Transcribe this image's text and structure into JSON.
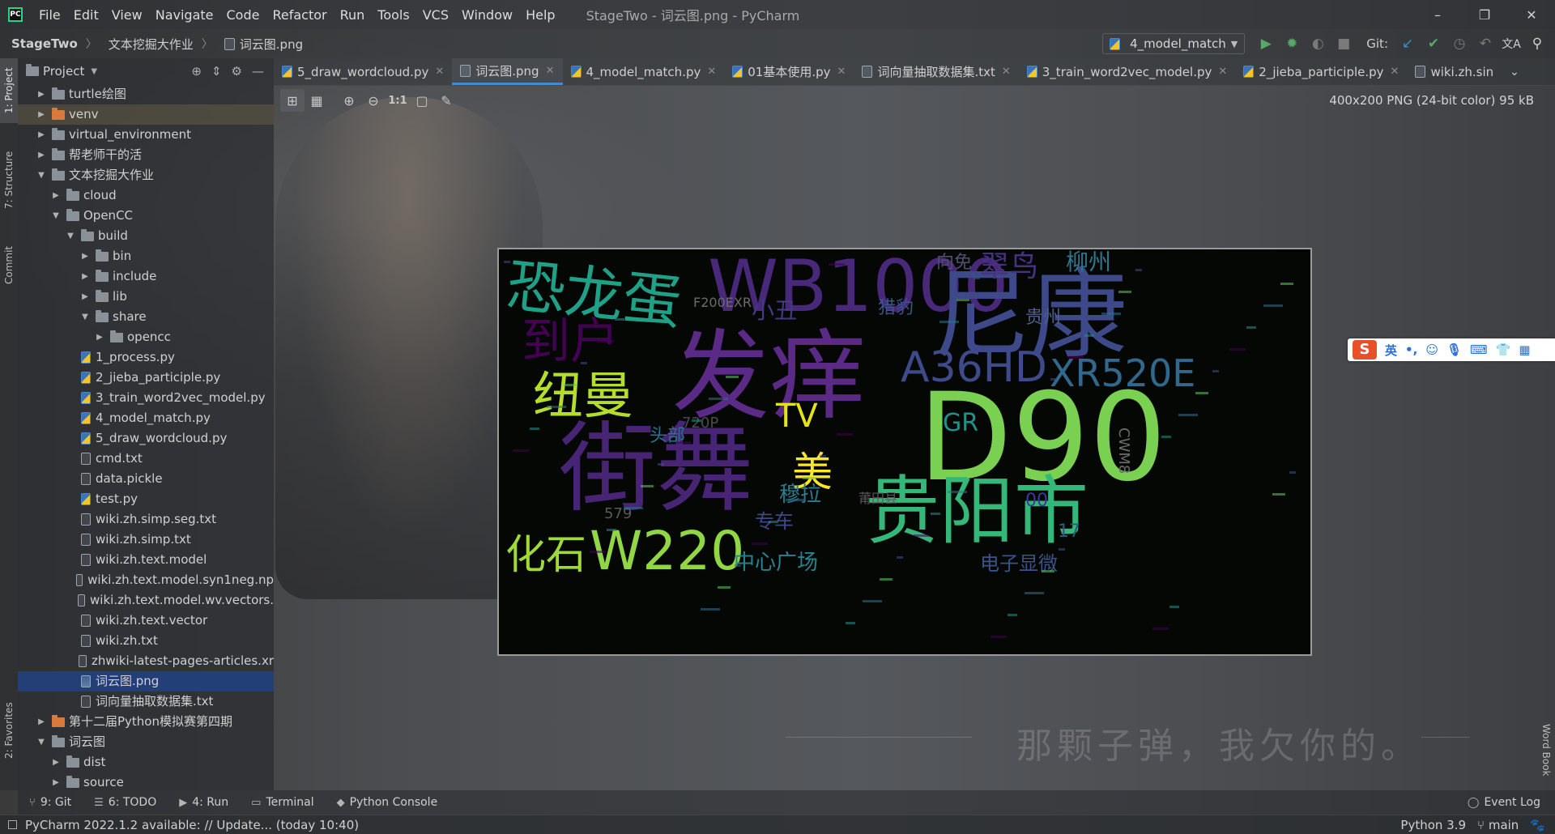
{
  "window": {
    "title": "StageTwo - 词云图.png - PyCharm",
    "controls": [
      "–",
      "❐",
      "✕"
    ]
  },
  "menu": [
    "File",
    "Edit",
    "View",
    "Navigate",
    "Code",
    "Refactor",
    "Run",
    "Tools",
    "VCS",
    "Window",
    "Help"
  ],
  "breadcrumb": [
    "StageTwo",
    "文本挖掘大作业",
    "词云图.png"
  ],
  "toolbar": {
    "run_config": "4_model_match",
    "git_label": "Git:"
  },
  "left_tool_tabs": [
    "1: Project",
    "7: Structure",
    "Commit",
    "2: Favorites"
  ],
  "project": {
    "header": "Project",
    "tree": [
      {
        "label": "turtle绘图",
        "type": "folder",
        "depth": 1,
        "arrow": "▶"
      },
      {
        "label": "venv",
        "type": "folder-orange",
        "depth": 1,
        "arrow": "▶"
      },
      {
        "label": "virtual_environment",
        "type": "folder",
        "depth": 1,
        "arrow": "▶"
      },
      {
        "label": "帮老师干的活",
        "type": "folder",
        "depth": 1,
        "arrow": "▶"
      },
      {
        "label": "文本挖掘大作业",
        "type": "folder",
        "depth": 1,
        "arrow": "▼"
      },
      {
        "label": "cloud",
        "type": "folder",
        "depth": 2,
        "arrow": "▶"
      },
      {
        "label": "OpenCC",
        "type": "folder",
        "depth": 2,
        "arrow": "▼"
      },
      {
        "label": "build",
        "type": "folder",
        "depth": 3,
        "arrow": "▼"
      },
      {
        "label": "bin",
        "type": "folder",
        "depth": 4,
        "arrow": "▶"
      },
      {
        "label": "include",
        "type": "folder",
        "depth": 4,
        "arrow": "▶"
      },
      {
        "label": "lib",
        "type": "folder",
        "depth": 4,
        "arrow": "▶"
      },
      {
        "label": "share",
        "type": "folder",
        "depth": 4,
        "arrow": "▼"
      },
      {
        "label": "opencc",
        "type": "folder",
        "depth": 5,
        "arrow": "▶"
      },
      {
        "label": "1_process.py",
        "type": "py",
        "depth": 3,
        "arrow": ""
      },
      {
        "label": "2_jieba_participle.py",
        "type": "py",
        "depth": 3,
        "arrow": ""
      },
      {
        "label": "3_train_word2vec_model.py",
        "type": "py",
        "depth": 3,
        "arrow": ""
      },
      {
        "label": "4_model_match.py",
        "type": "py",
        "depth": 3,
        "arrow": ""
      },
      {
        "label": "5_draw_wordcloud.py",
        "type": "py",
        "depth": 3,
        "arrow": ""
      },
      {
        "label": "cmd.txt",
        "type": "file",
        "depth": 3,
        "arrow": ""
      },
      {
        "label": "data.pickle",
        "type": "file",
        "depth": 3,
        "arrow": ""
      },
      {
        "label": "test.py",
        "type": "py",
        "depth": 3,
        "arrow": ""
      },
      {
        "label": "wiki.zh.simp.seg.txt",
        "type": "file",
        "depth": 3,
        "arrow": ""
      },
      {
        "label": "wiki.zh.simp.txt",
        "type": "file",
        "depth": 3,
        "arrow": ""
      },
      {
        "label": "wiki.zh.text.model",
        "type": "file",
        "depth": 3,
        "arrow": ""
      },
      {
        "label": "wiki.zh.text.model.syn1neg.np",
        "type": "file",
        "depth": 3,
        "arrow": ""
      },
      {
        "label": "wiki.zh.text.model.wv.vectors.",
        "type": "file",
        "depth": 3,
        "arrow": ""
      },
      {
        "label": "wiki.zh.text.vector",
        "type": "file",
        "depth": 3,
        "arrow": ""
      },
      {
        "label": "wiki.zh.txt",
        "type": "file",
        "depth": 3,
        "arrow": ""
      },
      {
        "label": "zhwiki-latest-pages-articles.xr",
        "type": "file",
        "depth": 3,
        "arrow": ""
      },
      {
        "label": "词云图.png",
        "type": "img",
        "depth": 3,
        "arrow": "",
        "selected": true
      },
      {
        "label": "词向量抽取数据集.txt",
        "type": "file",
        "depth": 3,
        "arrow": ""
      },
      {
        "label": "第十二届Python模拟赛第四期",
        "type": "folder-orange",
        "depth": 1,
        "arrow": "▶"
      },
      {
        "label": "词云图",
        "type": "folder",
        "depth": 1,
        "arrow": "▼"
      },
      {
        "label": "dist",
        "type": "folder",
        "depth": 2,
        "arrow": "▶"
      },
      {
        "label": "source",
        "type": "folder",
        "depth": 2,
        "arrow": "▶"
      }
    ]
  },
  "tabs": [
    {
      "label": "5_draw_wordcloud.py",
      "type": "py",
      "active": false
    },
    {
      "label": "词云图.png",
      "type": "img",
      "active": true
    },
    {
      "label": "4_model_match.py",
      "type": "py",
      "active": false
    },
    {
      "label": "01基本使用.py",
      "type": "py",
      "active": false
    },
    {
      "label": "词向量抽取数据集.txt",
      "type": "file",
      "active": false
    },
    {
      "label": "3_train_word2vec_model.py",
      "type": "py",
      "active": false
    },
    {
      "label": "2_jieba_participle.py",
      "type": "py",
      "active": false
    },
    {
      "label": "wiki.zh.sin",
      "type": "file",
      "active": false
    }
  ],
  "viewer": {
    "image_info": "400x200 PNG (24-bit color) 95 kB",
    "zoom_actual": "1:1"
  },
  "wordcloud_words": [
    {
      "text": "恐龙蛋",
      "color": "#1fa187"
    },
    {
      "text": "WB1000",
      "color": "#482878"
    },
    {
      "text": "尼康",
      "color": "#3e4989"
    },
    {
      "text": "发痒",
      "color": "#5b2a87"
    },
    {
      "text": "D90",
      "color": "#7ad151"
    },
    {
      "text": "A36HD",
      "color": "#3e4a89"
    },
    {
      "text": "XR520E",
      "color": "#31688e"
    },
    {
      "text": "街舞",
      "color": "#482475"
    },
    {
      "text": "贵阳市",
      "color": "#35b779"
    },
    {
      "text": "到户",
      "color": "#440154"
    },
    {
      "text": "纽曼",
      "color": "#b5de2b"
    },
    {
      "text": "化石",
      "color": "#a0da39"
    },
    {
      "text": "W220",
      "color": "#90d743"
    },
    {
      "text": "TV",
      "color": "#e5e419"
    },
    {
      "text": "美",
      "color": "#fde725"
    },
    {
      "text": "翠鸟",
      "color": "#46327e"
    },
    {
      "text": "柳州",
      "color": "#2a788e"
    },
    {
      "text": "中心广场",
      "color": "#26828e"
    },
    {
      "text": "电子显微",
      "color": "#3b528b"
    },
    {
      "text": "GR",
      "color": "#21918c"
    },
    {
      "text": "F200EXR",
      "color": "#6b6b6b"
    },
    {
      "text": "小丑",
      "color": "#443983"
    },
    {
      "text": "720P",
      "color": "#4a4a4a"
    },
    {
      "text": "579",
      "color": "#5a5a5a"
    },
    {
      "text": "专车",
      "color": "#3f4788"
    },
    {
      "text": "头部",
      "color": "#2c728e"
    },
    {
      "text": "穆拉",
      "color": "#287c8e"
    },
    {
      "text": "猎豹",
      "color": "#3a548c"
    },
    {
      "text": "向免",
      "color": "#4f4f6f"
    },
    {
      "text": "贵州",
      "color": "#4e5f8a"
    },
    {
      "text": "莆田县",
      "color": "#5a5a5a"
    },
    {
      "text": "17",
      "color": "#2c5b7a"
    },
    {
      "text": "CWM8",
      "color": "#6b6b6b"
    },
    {
      "text": "00",
      "color": "#3a3a9a"
    }
  ],
  "right_tool_tabs": [
    "Word Book"
  ],
  "bottom_tools": [
    {
      "label": "9: Git",
      "icon": "⑂"
    },
    {
      "label": "6: TODO",
      "icon": "☰"
    },
    {
      "label": "4: Run",
      "icon": "▶"
    },
    {
      "label": "Terminal",
      "icon": "▭"
    },
    {
      "label": "Python Console",
      "icon": "◆"
    }
  ],
  "event_log": "Event Log",
  "status": {
    "message": "PyCharm 2022.1.2 available: // Update... (today 10:40)",
    "interpreter": "Python 3.9",
    "branch": "main"
  },
  "background": {
    "quote": "那颗子弹，我欠你的。"
  },
  "ime": {
    "logo": "S",
    "mode": "英"
  }
}
